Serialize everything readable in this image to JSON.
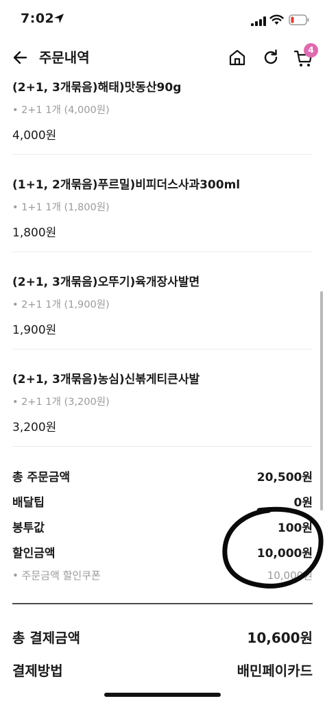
{
  "status_bar": {
    "time": "7:02"
  },
  "header": {
    "title": "주문내역",
    "cart_count": "4"
  },
  "items": [
    {
      "name": "(2+1, 3개묶음)해태)맛동산90g",
      "option": "• 2+1 1개 (4,000원)",
      "price": "4,000원"
    },
    {
      "name": "(1+1, 2개묶음)푸르밀)비피더스사과300ml",
      "option": "• 1+1 1개 (1,800원)",
      "price": "1,800원"
    },
    {
      "name": "(2+1, 3개묶음)오뚜기)육개장사발면",
      "option": "• 2+1 1개 (1,900원)",
      "price": "1,900원"
    },
    {
      "name": "(2+1, 3개묶음)농심)신볶게티큰사발",
      "option": "• 2+1 1개 (3,200원)",
      "price": "3,200원"
    }
  ],
  "summary": {
    "total_order_label": "총 주문금액",
    "total_order_value": "20,500원",
    "delivery_tip_label": "배달팁",
    "delivery_tip_value": "0원",
    "bag_fee_label": "봉투값",
    "bag_fee_value": "100원",
    "discount_label": "할인금액",
    "discount_value": "10,000원",
    "coupon_label": "• 주문금액 할인쿠폰",
    "coupon_value": "10,000원"
  },
  "payment": {
    "total_label": "총 결제금액",
    "total_value": "10,600원",
    "method_label": "결제방법",
    "method_value": "배민페이카드"
  },
  "colors": {
    "badge": "#e06ab0",
    "muted_text": "#9a9a9a",
    "divider": "#ececec"
  }
}
